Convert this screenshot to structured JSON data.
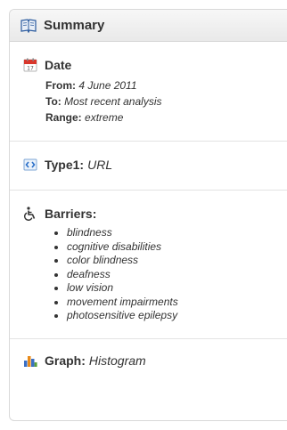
{
  "header": {
    "title": "Summary",
    "icon": "book-icon"
  },
  "date": {
    "label": "Date",
    "icon": "calendar-icon",
    "from_key": "From:",
    "from_value": "4 June 2011",
    "to_key": "To:",
    "to_value": "Most recent analysis",
    "range_key": "Range:",
    "range_value": "extreme"
  },
  "type": {
    "label": "Type1:",
    "value": "URL",
    "icon": "link-code-icon"
  },
  "barriers": {
    "label": "Barriers:",
    "icon": "wheelchair-icon",
    "items": [
      "blindness",
      "cognitive disabilities",
      "color blindness",
      "deafness",
      "low vision",
      "movement impairments",
      "photosensitive epilepsy"
    ]
  },
  "graph": {
    "label": "Graph:",
    "value": "Histogram",
    "icon": "bar-chart-icon"
  },
  "colors": {
    "border": "#d9d9d9",
    "header_bg": "#eeeeee",
    "text": "#333333",
    "calendar_red": "#d9362b",
    "chart_blue": "#3a6fc4",
    "chart_orange": "#e88a1a"
  }
}
